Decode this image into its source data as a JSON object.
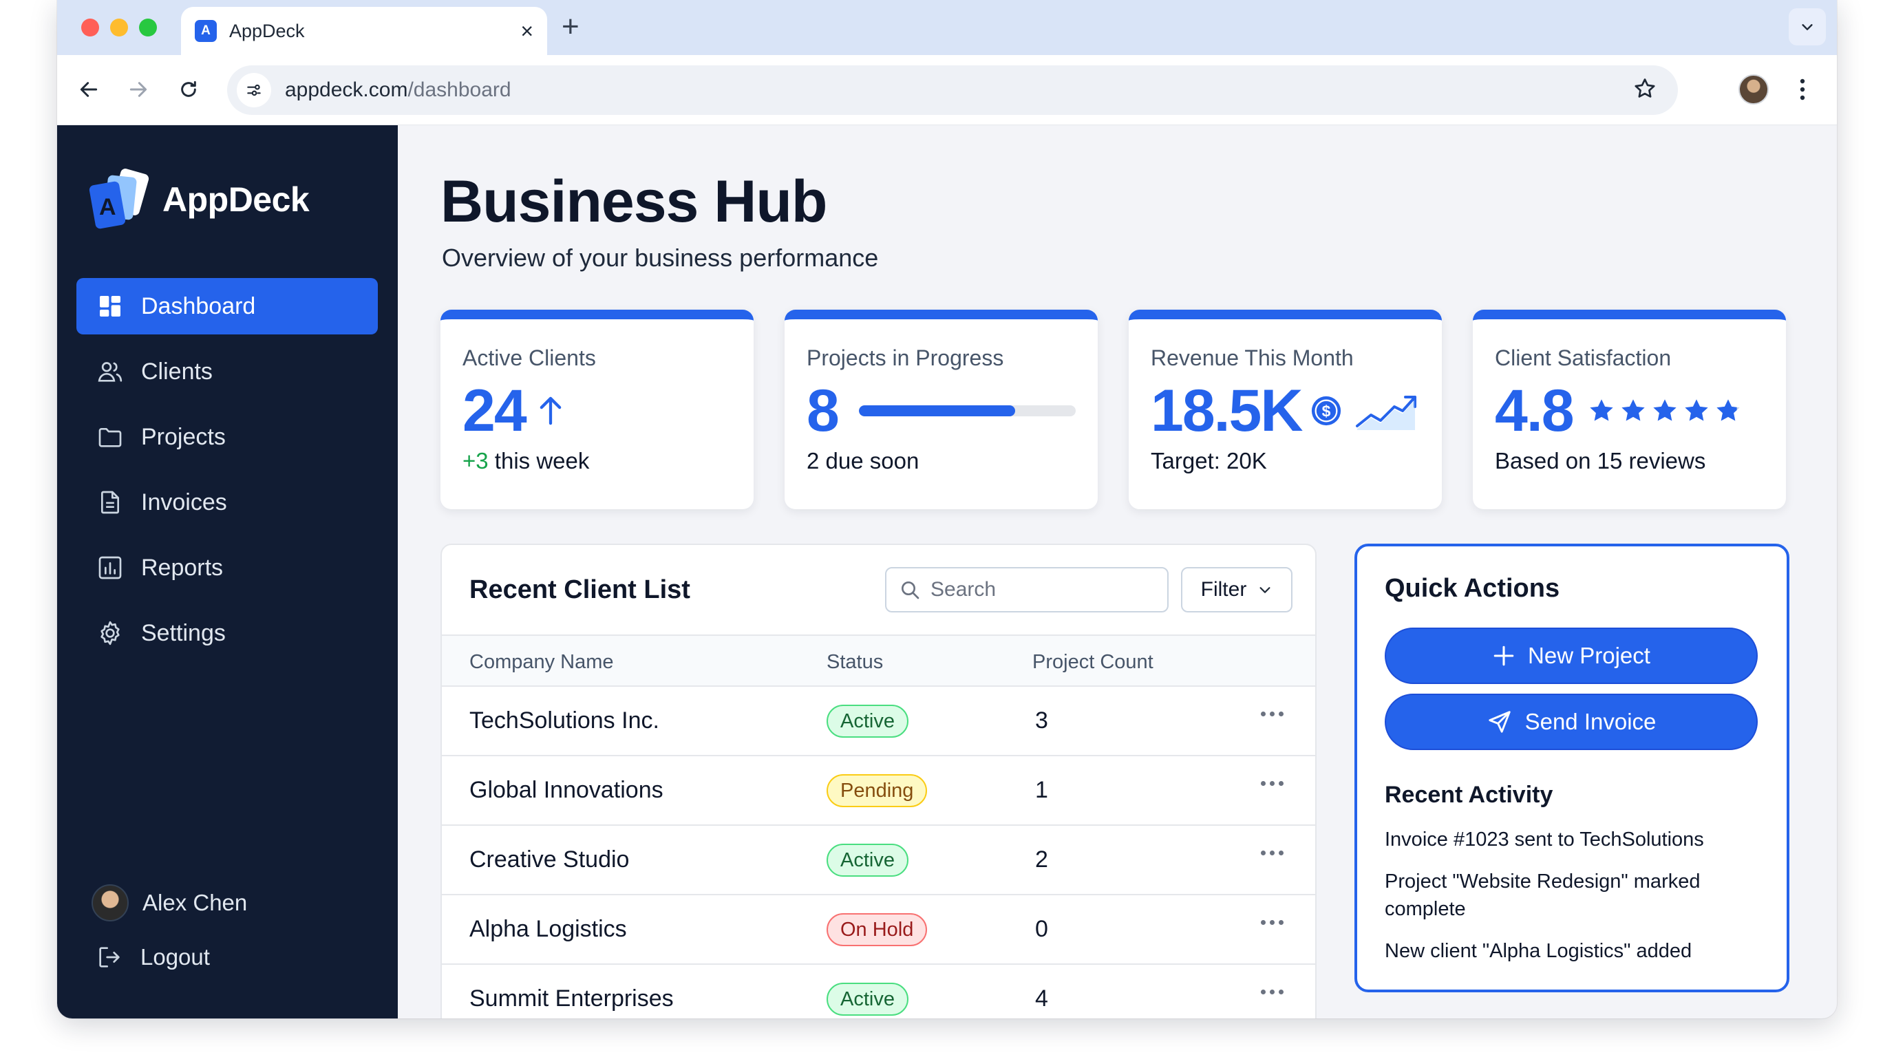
{
  "browser": {
    "tab_title": "AppDeck",
    "favicon_letter": "A",
    "url_host": "appdeck.com",
    "url_path": "/dashboard",
    "traffic_lights": [
      "#ff5f57",
      "#febc2e",
      "#28c840"
    ]
  },
  "sidebar": {
    "brand": "AppDeck",
    "brand_letter": "A",
    "items": [
      {
        "label": "Dashboard",
        "icon": "dashboard-icon",
        "active": true
      },
      {
        "label": "Clients",
        "icon": "users-icon",
        "active": false
      },
      {
        "label": "Projects",
        "icon": "folder-icon",
        "active": false
      },
      {
        "label": "Invoices",
        "icon": "document-icon",
        "active": false
      },
      {
        "label": "Reports",
        "icon": "bar-chart-icon",
        "active": false
      },
      {
        "label": "Settings",
        "icon": "gear-icon",
        "active": false
      }
    ],
    "user_name": "Alex Chen",
    "logout_label": "Logout"
  },
  "page": {
    "title": "Business Hub",
    "subtitle": "Overview of your business performance"
  },
  "stats": [
    {
      "label": "Active Clients",
      "value": "24",
      "delta": "+3",
      "foot_suffix": " this week",
      "icon": "arrow-up-icon"
    },
    {
      "label": "Projects in Progress",
      "value": "8",
      "foot": "2 due soon",
      "progress": 0.72
    },
    {
      "label": "Revenue This Month",
      "value": "18.5K",
      "foot": "Target: 20K",
      "icons": [
        "dollar-coin-icon",
        "trend-up-icon"
      ]
    },
    {
      "label": "Client Satisfaction",
      "value": "4.8",
      "foot": "Based on 15 reviews",
      "rating": 4.8,
      "rating_max": 5
    }
  ],
  "client_table": {
    "title": "Recent Client List",
    "search_placeholder": "Search",
    "filter_label": "Filter",
    "columns": [
      "Company Name",
      "Status",
      "Project Count"
    ],
    "rows": [
      {
        "company": "TechSolutions Inc.",
        "status": "Active",
        "status_type": "active",
        "count": "3"
      },
      {
        "company": "Global Innovations",
        "status": "Pending",
        "status_type": "pending",
        "count": "1"
      },
      {
        "company": "Creative Studio",
        "status": "Active",
        "status_type": "active",
        "count": "2"
      },
      {
        "company": "Alpha Logistics",
        "status": "On Hold",
        "status_type": "hold",
        "count": "0"
      },
      {
        "company": "Summit Enterprises",
        "status": "Active",
        "status_type": "active",
        "count": "4"
      }
    ]
  },
  "quick_actions": {
    "title": "Quick Actions",
    "new_project_label": "New Project",
    "send_invoice_label": "Send Invoice",
    "activity_title": "Recent Activity",
    "activity": [
      "Invoice #1023 sent to TechSolutions",
      "Project \"Website Redesign\" marked complete",
      "New client \"Alpha Logistics\" added"
    ]
  },
  "colors": {
    "accent": "#2563eb",
    "sidebar_bg": "#111c33",
    "star": "#2563eb",
    "success": "#16a34a"
  }
}
